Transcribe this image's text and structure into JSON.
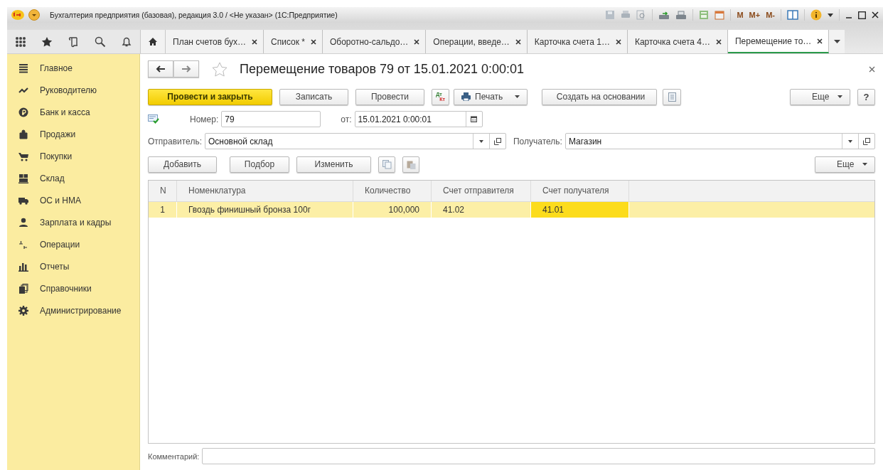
{
  "window": {
    "title": "Бухгалтерия предприятия (базовая), редакция 3.0 / <Не указан>  (1С:Предприятие)",
    "memory_buttons": [
      "M",
      "M+",
      "M-"
    ]
  },
  "tabs": [
    {
      "label": "План счетов бух…",
      "selected": false
    },
    {
      "label": "Список *",
      "selected": false
    },
    {
      "label": "Оборотно-сальдо…",
      "selected": false
    },
    {
      "label": "Операции, введе…",
      "selected": false
    },
    {
      "label": "Карточка счета 1…",
      "selected": false
    },
    {
      "label": "Карточка счета 4…",
      "selected": false
    },
    {
      "label": "Перемещение то…",
      "selected": true
    }
  ],
  "sidebar": {
    "items": [
      {
        "label": "Главное"
      },
      {
        "label": "Руководителю"
      },
      {
        "label": "Банк и касса"
      },
      {
        "label": "Продажи"
      },
      {
        "label": "Покупки"
      },
      {
        "label": "Склад"
      },
      {
        "label": "ОС и НМА"
      },
      {
        "label": "Зарплата и кадры"
      },
      {
        "label": "Операции"
      },
      {
        "label": "Отчеты"
      },
      {
        "label": "Справочники"
      },
      {
        "label": "Администрирование"
      }
    ]
  },
  "document": {
    "title": "Перемещение товаров 79 от 15.01.2021 0:00:01",
    "commands": {
      "post_close": "Провести и закрыть",
      "save": "Записать",
      "post": "Провести",
      "dtkt": "Дт Кт",
      "print": "Печать",
      "create_based": "Создать на основании",
      "more": "Еще",
      "help": "?"
    },
    "number": {
      "label": "Номер:",
      "value": "79"
    },
    "date": {
      "label": "от:",
      "value": "15.01.2021  0:00:01"
    },
    "sender": {
      "label": "Отправитель:",
      "value": "Основной склад"
    },
    "receiver": {
      "label": "Получатель:",
      "value": "Магазин"
    },
    "table_commands": {
      "add": "Добавить",
      "pick": "Подбор",
      "edit": "Изменить",
      "more": "Еще"
    },
    "table": {
      "columns": [
        "N",
        "Номенклатура",
        "Количество",
        "Счет отправителя",
        "Счет получателя"
      ],
      "rows": [
        {
          "selected": true,
          "cells": [
            {
              "text": "1",
              "selected": false
            },
            {
              "text": "Гвоздь финишный бронза 100г",
              "selected": false
            },
            {
              "text": "100,000",
              "selected": false
            },
            {
              "text": "41.02",
              "selected": false
            },
            {
              "text": "41.01",
              "selected": true
            }
          ]
        }
      ]
    },
    "comment": {
      "label": "Комментарий:"
    }
  }
}
